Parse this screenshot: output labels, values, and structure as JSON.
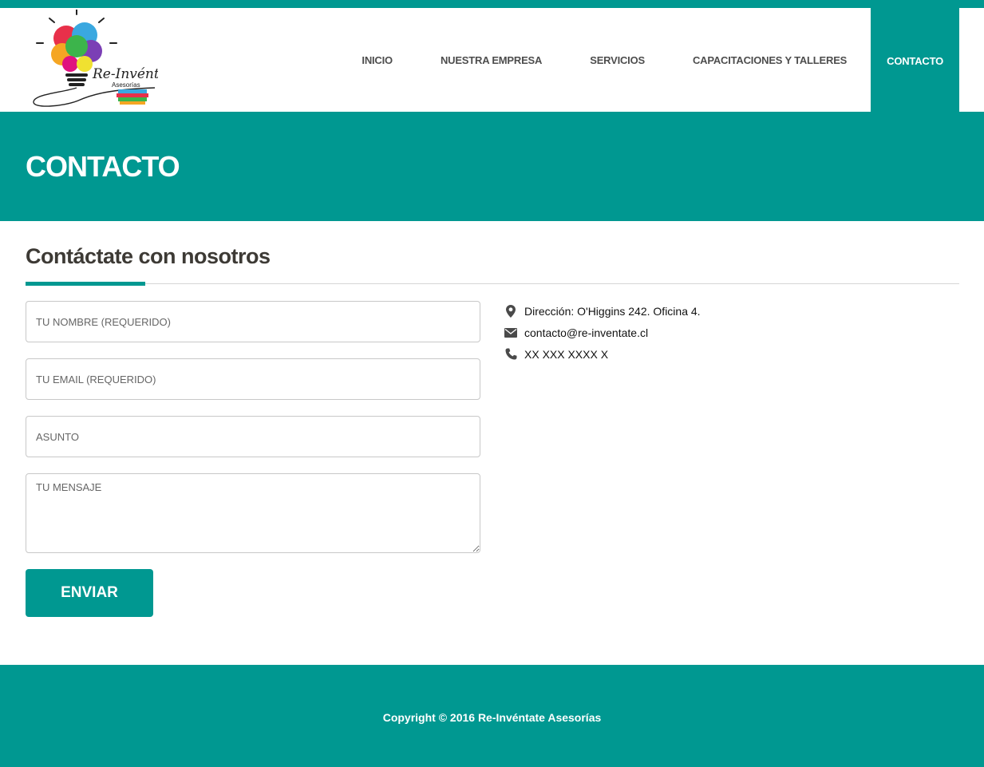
{
  "brand": {
    "logo_name": "Re-Invéntate",
    "logo_sub": "Asesorías"
  },
  "nav": {
    "items": [
      {
        "label": "INICIO"
      },
      {
        "label": "NUESTRA EMPRESA"
      },
      {
        "label": "SERVICIOS"
      },
      {
        "label": "CAPACITACIONES Y TALLERES"
      },
      {
        "label": "CONTACTO"
      }
    ],
    "active": "CONTACTO"
  },
  "banner": {
    "title": "CONTACTO"
  },
  "contact_section": {
    "title": "Contáctate con nosotros",
    "form": {
      "name_placeholder": "TU NOMBRE (REQUERIDO)",
      "email_placeholder": "TU EMAIL (REQUERIDO)",
      "subject_placeholder": "ASUNTO",
      "message_placeholder": "TU MENSAJE",
      "submit_label": "ENVIAR"
    },
    "info": {
      "address": "Dirección: O'Higgins 242. Oficina 4.",
      "email": "contacto@re-inventate.cl",
      "phone": "XX XXX XXXX X",
      "icons": [
        "map-pin-icon",
        "envelope-icon",
        "phone-icon"
      ]
    }
  },
  "footer": {
    "copyright": "Copyright © 2016 Re-Invéntate Asesorías"
  },
  "colors": {
    "accent": "#009891",
    "accent_dark": "#00807a",
    "text": "#3d3a35"
  }
}
